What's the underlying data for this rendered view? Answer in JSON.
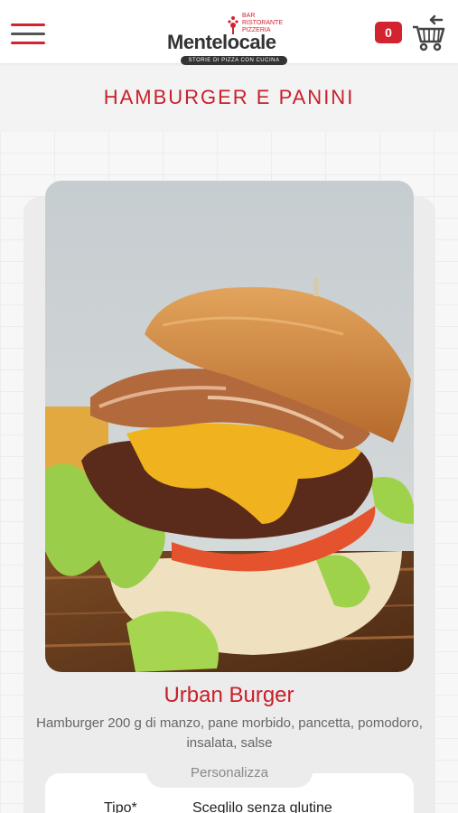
{
  "header": {
    "menu_icon": "hamburger-menu-icon",
    "logo": {
      "brand": "Mentelocale",
      "sub_lines": [
        "BAR",
        "RISTORANTE",
        "PIZZERIA"
      ],
      "tagline": "STORIE DI PIZZA CON CUCINA"
    },
    "cart_count": "0",
    "cart_icon": "shopping-cart-icon",
    "accent_color": "#d3232f"
  },
  "category": {
    "title": "HAMBURGER E PANINI"
  },
  "product": {
    "image": "burger-photo",
    "name": "Urban Burger",
    "description": "Hamburger 200 g di manzo, pane morbido, pancetta, pomodoro, insalata, salse",
    "customize_label": "Personalizza",
    "option_label": "Tipo*",
    "option_value": "Sceglilo senza glutine"
  }
}
